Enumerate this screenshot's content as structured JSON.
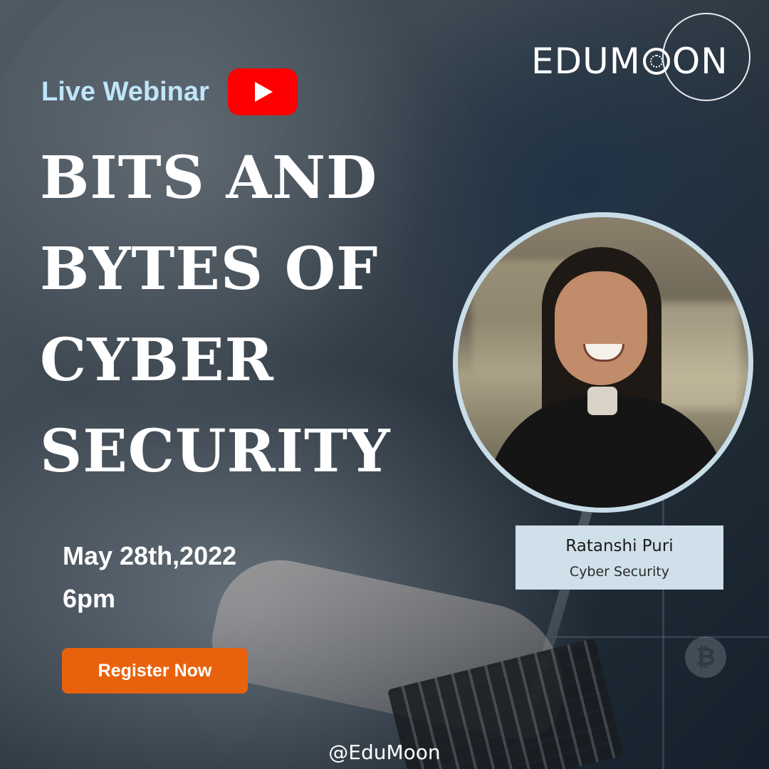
{
  "brand": {
    "logo_text_left": "EDUM",
    "logo_text_right": "ON",
    "handle": "@EduMoon"
  },
  "header": {
    "live_label": "Live Webinar",
    "video_icon": "youtube-play-icon"
  },
  "title": {
    "lines": [
      "BITS AND",
      "BYTES OF",
      "CYBER",
      "SECURITY"
    ]
  },
  "event": {
    "date": "May 28th,2022",
    "time": "6pm"
  },
  "cta": {
    "register_label": "Register Now"
  },
  "speaker": {
    "name": "Ratanshi Puri",
    "role": "Cyber Security"
  },
  "colors": {
    "accent": "#e8620d",
    "live_label": "#bfe6fa",
    "youtube": "#ff0000",
    "caption_bg": "#cfe0ea"
  }
}
